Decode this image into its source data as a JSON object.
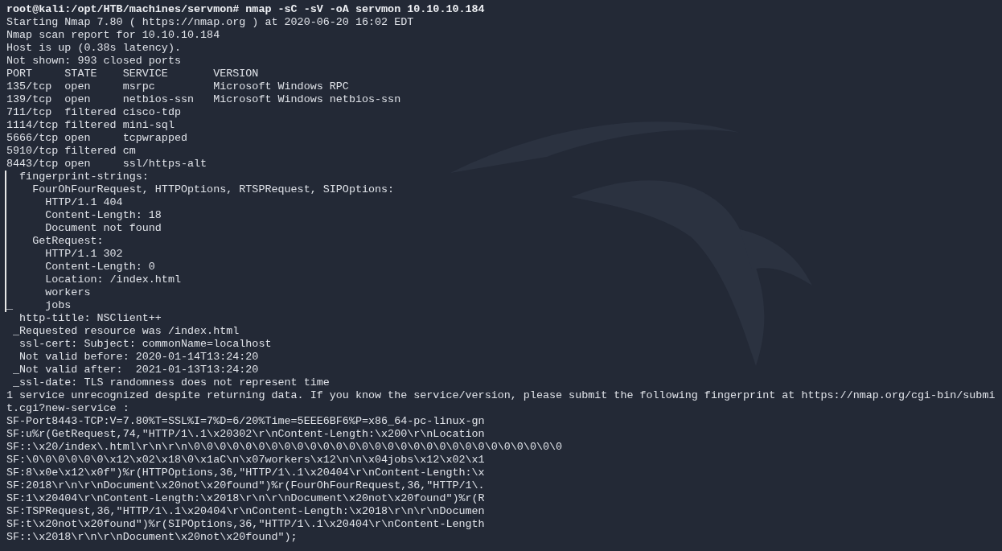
{
  "terminal": {
    "lines": [
      {
        "kind": "prompt",
        "text": "root@kali:/opt/HTB/machines/servmon# nmap -sC -sV -oA servmon 10.10.10.184"
      },
      {
        "kind": "output",
        "text": "Starting Nmap 7.80 ( https://nmap.org ) at 2020-06-20 16:02 EDT"
      },
      {
        "kind": "output",
        "text": "Nmap scan report for 10.10.10.184"
      },
      {
        "kind": "output",
        "text": "Host is up (0.38s latency)."
      },
      {
        "kind": "output",
        "text": "Not shown: 993 closed ports"
      },
      {
        "kind": "output",
        "text": "PORT     STATE    SERVICE       VERSION"
      },
      {
        "kind": "output",
        "text": "135/tcp  open     msrpc         Microsoft Windows RPC"
      },
      {
        "kind": "output",
        "text": "139/tcp  open     netbios-ssn   Microsoft Windows netbios-ssn"
      },
      {
        "kind": "output",
        "text": "711/tcp  filtered cisco-tdp"
      },
      {
        "kind": "output",
        "text": "1114/tcp filtered mini-sql"
      },
      {
        "kind": "output",
        "text": "5666/tcp open     tcpwrapped"
      },
      {
        "kind": "output",
        "text": "5910/tcp filtered cm"
      },
      {
        "kind": "output",
        "text": "8443/tcp open     ssl/https-alt"
      },
      {
        "kind": "script",
        "text": "  fingerprint-strings:"
      },
      {
        "kind": "script",
        "text": "    FourOhFourRequest, HTTPOptions, RTSPRequest, SIPOptions:"
      },
      {
        "kind": "script",
        "text": "      HTTP/1.1 404"
      },
      {
        "kind": "script",
        "text": "      Content-Length: 18"
      },
      {
        "kind": "script",
        "text": "      Document not found"
      },
      {
        "kind": "script",
        "text": "    GetRequest:"
      },
      {
        "kind": "script",
        "text": "      HTTP/1.1 302"
      },
      {
        "kind": "script",
        "text": "      Content-Length: 0"
      },
      {
        "kind": "script",
        "text": "      Location: /index.html"
      },
      {
        "kind": "script",
        "text": "      workers"
      },
      {
        "kind": "script",
        "text": "_     jobs"
      },
      {
        "kind": "output",
        "text": "  http-title: NSClient++"
      },
      {
        "kind": "output",
        "text": " _Requested resource was /index.html"
      },
      {
        "kind": "output",
        "text": "  ssl-cert: Subject: commonName=localhost"
      },
      {
        "kind": "output",
        "text": "  Not valid before: 2020-01-14T13:24:20"
      },
      {
        "kind": "output",
        "text": " _Not valid after:  2021-01-13T13:24:20"
      },
      {
        "kind": "output",
        "text": " _ssl-date: TLS randomness does not represent time"
      },
      {
        "kind": "output",
        "text": "1 service unrecognized despite returning data. If you know the service/version, please submit the following fingerprint at https://nmap.org/cgi-bin/submi"
      },
      {
        "kind": "output",
        "text": "t.cgi?new-service :"
      },
      {
        "kind": "output",
        "text": "SF-Port8443-TCP:V=7.80%T=SSL%I=7%D=6/20%Time=5EEE6BF6%P=x86_64-pc-linux-gn"
      },
      {
        "kind": "output",
        "text": "SF:u%r(GetRequest,74,\"HTTP/1\\.1\\x20302\\r\\nContent-Length:\\x200\\r\\nLocation"
      },
      {
        "kind": "output",
        "text": "SF::\\x20/index\\.html\\r\\n\\r\\n\\0\\0\\0\\0\\0\\0\\0\\0\\0\\0\\0\\0\\0\\0\\0\\0\\0\\0\\0\\0\\0\\0\\0\\0\\0\\0\\0\\0\\0"
      },
      {
        "kind": "output",
        "text": "SF:\\0\\0\\0\\0\\0\\0\\x12\\x02\\x18\\0\\x1aC\\n\\x07workers\\x12\\n\\n\\x04jobs\\x12\\x02\\x1"
      },
      {
        "kind": "output",
        "text": "SF:8\\x0e\\x12\\x0f\")%r(HTTPOptions,36,\"HTTP/1\\.1\\x20404\\r\\nContent-Length:\\x"
      },
      {
        "kind": "output",
        "text": "SF:2018\\r\\n\\r\\nDocument\\x20not\\x20found\")%r(FourOhFourRequest,36,\"HTTP/1\\."
      },
      {
        "kind": "output",
        "text": "SF:1\\x20404\\r\\nContent-Length:\\x2018\\r\\n\\r\\nDocument\\x20not\\x20found\")%r(R"
      },
      {
        "kind": "output",
        "text": "SF:TSPRequest,36,\"HTTP/1\\.1\\x20404\\r\\nContent-Length:\\x2018\\r\\n\\r\\nDocumen"
      },
      {
        "kind": "output",
        "text": "SF:t\\x20not\\x20found\")%r(SIPOptions,36,\"HTTP/1\\.1\\x20404\\r\\nContent-Length"
      },
      {
        "kind": "output",
        "text": "SF::\\x2018\\r\\n\\r\\nDocument\\x20not\\x20found\");"
      }
    ]
  }
}
